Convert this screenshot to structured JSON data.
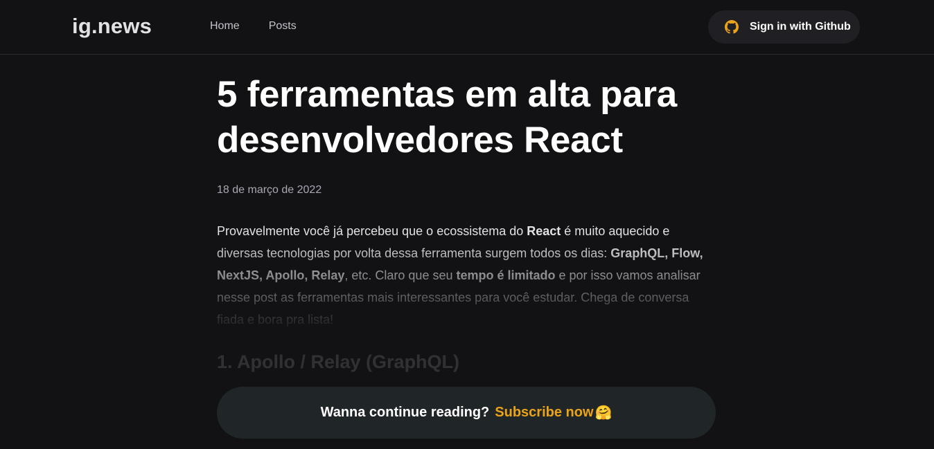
{
  "header": {
    "logo": "ig.news",
    "nav": [
      {
        "label": "Home"
      },
      {
        "label": "Posts"
      }
    ],
    "signin_label": "Sign in with Github",
    "signin_icon": "github-icon",
    "accent": "#eba417"
  },
  "post": {
    "title": "5 ferramentas em alta para desenvolvedores React",
    "date": "18 de março de 2022",
    "paragraph": {
      "t1": "Provavelmente você já percebeu que o ecossistema do ",
      "b1": "React",
      "t2": " é muito aquecido e diversas tecnologias por volta dessa ferramenta surgem todos os dias: ",
      "b2": "GraphQL, Flow, NextJS, Apollo, Relay",
      "t3": ", etc. Claro que seu ",
      "b3": "tempo é limitado",
      "t4": " e por isso vamos analisar nesse post as ferramentas mais interessantes para você estudar. Chega de conversa fiada e bora pra lista!"
    },
    "heading": "1. Apollo / Relay (GraphQL)"
  },
  "cta": {
    "text": "Wanna continue reading?",
    "link": "Subscribe now",
    "emoji": "🤗"
  }
}
